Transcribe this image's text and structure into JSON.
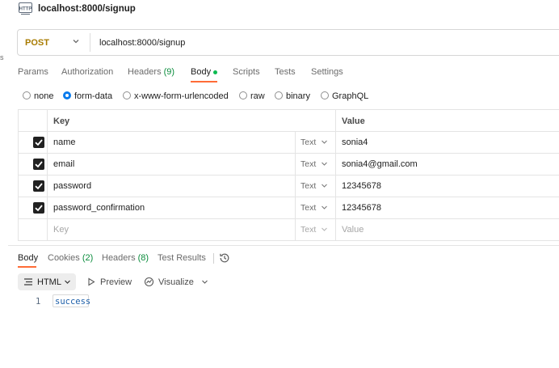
{
  "app": {
    "title": "localhost:8000/signup",
    "icon": "http-request-icon"
  },
  "left_edge_mark": "s",
  "request": {
    "method": "POST",
    "method_color": "#a87b00",
    "url": "localhost:8000/signup"
  },
  "request_tabs": [
    {
      "label": "Params"
    },
    {
      "label": "Authorization"
    },
    {
      "label": "Headers",
      "count": "(9)"
    },
    {
      "label": "Body",
      "active": true,
      "indicator": "green-dot"
    },
    {
      "label": "Scripts"
    },
    {
      "label": "Tests"
    },
    {
      "label": "Settings"
    }
  ],
  "body_types": [
    {
      "label": "none"
    },
    {
      "label": "form-data",
      "selected": true
    },
    {
      "label": "x-www-form-urlencoded"
    },
    {
      "label": "raw"
    },
    {
      "label": "binary"
    },
    {
      "label": "GraphQL"
    }
  ],
  "form_table": {
    "headers": {
      "key": "Key",
      "value": "Value"
    },
    "rows": [
      {
        "checked": true,
        "key": "name",
        "type": "Text",
        "value": "sonia4"
      },
      {
        "checked": true,
        "key": "email",
        "type": "Text",
        "value": "sonia4@gmail.com"
      },
      {
        "checked": true,
        "key": "password",
        "type": "Text",
        "value": "12345678"
      },
      {
        "checked": true,
        "key": "password_confirmation",
        "type": "Text",
        "value": "12345678"
      }
    ],
    "placeholder_row": {
      "key": "Key",
      "type": "Text",
      "value": "Value"
    }
  },
  "response_tabs": [
    {
      "label": "Body",
      "active": true
    },
    {
      "label": "Cookies",
      "count": "(2)"
    },
    {
      "label": "Headers",
      "count": "(8)"
    },
    {
      "label": "Test Results"
    }
  ],
  "response_toolbar": {
    "format": "HTML",
    "preview": "Preview",
    "visualize": "Visualize"
  },
  "response_body": {
    "lines": [
      {
        "number": "1",
        "text": "success"
      }
    ]
  },
  "colors": {
    "accent": "#ff6c37",
    "radio_selected": "#097bed",
    "count_green": "#0a8c3c",
    "code_text": "#1d5fa9"
  }
}
